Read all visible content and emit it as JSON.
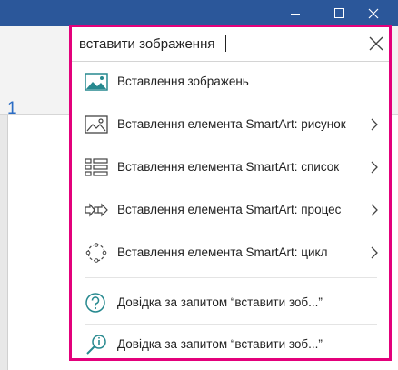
{
  "window": {
    "controls": [
      "minimize",
      "maximize",
      "close"
    ]
  },
  "ribbon": {
    "fragment_text": "1"
  },
  "search": {
    "query": "вставити зображення",
    "close_icon": "close-icon"
  },
  "results": [
    {
      "icon": "picture-icon",
      "label": "Вставлення зображень",
      "has_submenu": false
    },
    {
      "icon": "smartart-picture-icon",
      "label": "Вставлення елемента SmartArt: рисунок",
      "has_submenu": true
    },
    {
      "icon": "smartart-list-icon",
      "label": "Вставлення елемента SmartArt: список",
      "has_submenu": true
    },
    {
      "icon": "smartart-process-icon",
      "label": "Вставлення елемента SmartArt: процес",
      "has_submenu": true
    },
    {
      "icon": "smartart-cycle-icon",
      "label": "Вставлення елемента SmartArt: цикл",
      "has_submenu": true
    }
  ],
  "help": [
    {
      "icon": "help-icon",
      "label": "Довідка за запитом “вставити зоб...”"
    },
    {
      "icon": "smart-lookup-icon",
      "label": "Довідка за запитом “вставити зоб...”"
    }
  ],
  "colors": {
    "titlebar": "#2b579a",
    "highlight_border": "#e3007b",
    "icon_teal": "#27898f"
  }
}
